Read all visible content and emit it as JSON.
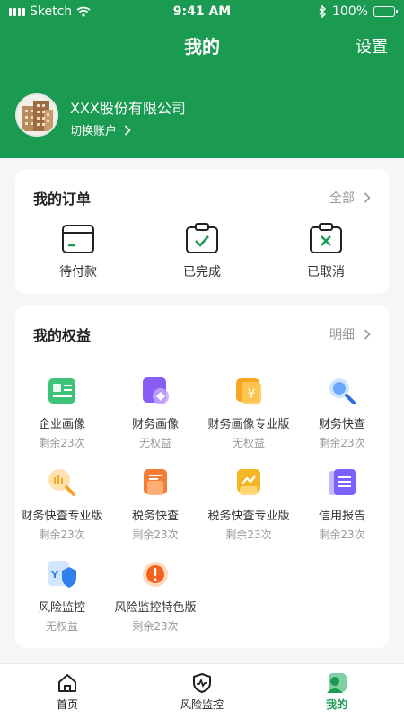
{
  "status_bar": {
    "carrier": "Sketch",
    "time": "9:41 AM",
    "battery": "100%"
  },
  "nav": {
    "title": "我的",
    "settings": "设置"
  },
  "account": {
    "company": "XXX股份有限公司",
    "switch_label": "切换账户"
  },
  "orders": {
    "title": "我的订单",
    "more": "全部",
    "items": [
      {
        "label": "待付款",
        "icon": "wallet-icon"
      },
      {
        "label": "已完成",
        "icon": "check-clipboard-icon"
      },
      {
        "label": "已取消",
        "icon": "cancel-clipboard-icon"
      }
    ]
  },
  "benefits": {
    "title": "我的权益",
    "more": "明细",
    "items": [
      {
        "name": "企业画像",
        "sub": "剩余23次",
        "icon": "company-profile-icon",
        "color": "#3ec37a"
      },
      {
        "name": "财务画像",
        "sub": "无权益",
        "icon": "finance-profile-icon",
        "color": "#8a5cf6"
      },
      {
        "name": "财务画像专业版",
        "sub": "无权益",
        "icon": "finance-pro-icon",
        "color": "#f5a623"
      },
      {
        "name": "财务快查",
        "sub": "剩余23次",
        "icon": "finance-search-icon",
        "color": "#4a90e2"
      },
      {
        "name": "财务快查专业版",
        "sub": "剩余23次",
        "icon": "finance-search-pro-icon",
        "color": "#f5a623"
      },
      {
        "name": "税务快查",
        "sub": "剩余23次",
        "icon": "tax-search-icon",
        "color": "#f57c36"
      },
      {
        "name": "税务快查专业版",
        "sub": "剩余23次",
        "icon": "tax-pro-icon",
        "color": "#f5b623"
      },
      {
        "name": "信用报告",
        "sub": "剩余23次",
        "icon": "credit-report-icon",
        "color": "#7b61ff"
      },
      {
        "name": "风险监控",
        "sub": "无权益",
        "icon": "risk-monitor-icon",
        "color": "#2f80ed"
      },
      {
        "name": "风险监控特色版",
        "sub": "剩余23次",
        "icon": "risk-monitor-special-icon",
        "color": "#f2611d"
      }
    ]
  },
  "tabbar": {
    "items": [
      {
        "label": "首页",
        "icon": "home-icon",
        "active": false
      },
      {
        "label": "风险监控",
        "icon": "shield-pulse-icon",
        "active": false
      },
      {
        "label": "我的",
        "icon": "profile-icon",
        "active": true
      }
    ]
  },
  "colors": {
    "brand": "#1b9b52",
    "card": "#ffffff",
    "background": "#f5f6f8",
    "muted": "#999999"
  }
}
